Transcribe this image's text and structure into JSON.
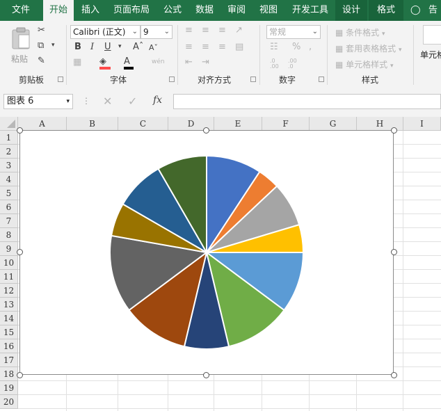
{
  "tabs": [
    {
      "label": "文件",
      "active": false,
      "ctx": false
    },
    {
      "label": "开始",
      "active": true,
      "ctx": false
    },
    {
      "label": "插入",
      "active": false,
      "ctx": false
    },
    {
      "label": "页面布局",
      "active": false,
      "ctx": false
    },
    {
      "label": "公式",
      "active": false,
      "ctx": false
    },
    {
      "label": "数据",
      "active": false,
      "ctx": false
    },
    {
      "label": "审阅",
      "active": false,
      "ctx": false
    },
    {
      "label": "视图",
      "active": false,
      "ctx": false
    },
    {
      "label": "开发工具",
      "active": false,
      "ctx": false
    },
    {
      "label": "设计",
      "active": false,
      "ctx": true
    },
    {
      "label": "格式",
      "active": false,
      "ctx": true
    }
  ],
  "tell_me": "告",
  "ribbon": {
    "clipboard": {
      "label": "剪贴板",
      "paste": "粘贴"
    },
    "font": {
      "label": "字体",
      "name": "Calibri (正文)",
      "size": "9"
    },
    "alignment": {
      "label": "对齐方式"
    },
    "number": {
      "label": "数字",
      "format": "常规"
    },
    "styles": {
      "label": "样式",
      "conditional": "条件格式",
      "table_format": "套用表格格式",
      "cell_styles": "单元格样式"
    },
    "cells": {
      "label": "单元格"
    }
  },
  "namebox": "图表 6",
  "columns": [
    "A",
    "B",
    "C",
    "D",
    "E",
    "F",
    "G",
    "H",
    "I"
  ],
  "rows": [
    "1",
    "2",
    "3",
    "4",
    "5",
    "6",
    "7",
    "8",
    "9",
    "10",
    "11",
    "12",
    "13",
    "14",
    "15",
    "16",
    "17",
    "18",
    "19",
    "20"
  ],
  "chart_data": {
    "type": "pie",
    "values": [
      10,
      4,
      8,
      5,
      11,
      12,
      8,
      12,
      14,
      6,
      9,
      9
    ],
    "colors": [
      "#4472c4",
      "#ed7d31",
      "#a5a5a5",
      "#ffc000",
      "#5b9bd5",
      "#70ad47",
      "#264478",
      "#9e480e",
      "#636363",
      "#997300",
      "#255e91",
      "#43682b"
    ]
  }
}
